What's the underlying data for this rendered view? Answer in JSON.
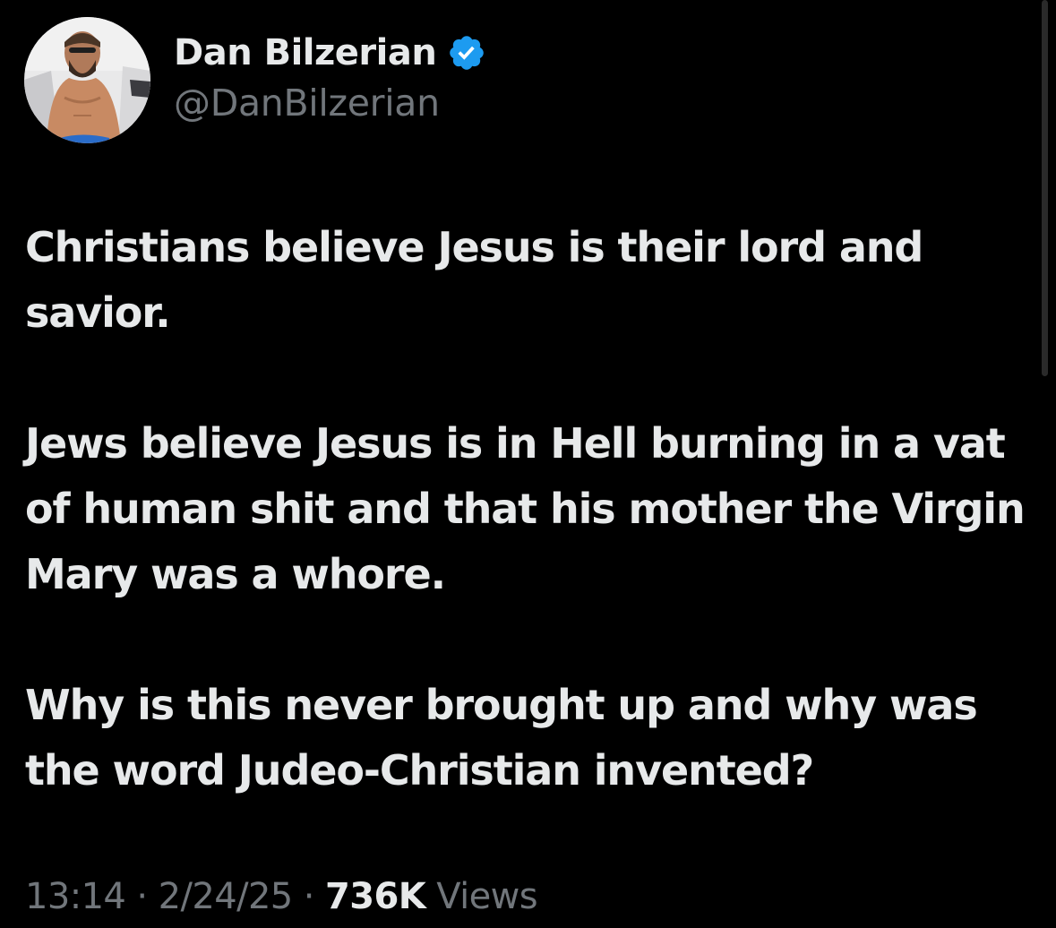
{
  "author": {
    "display_name": "Dan Bilzerian",
    "handle": "@DanBilzerian",
    "verified_icon": "verified-badge-icon",
    "verified_color": "#1d9bf0",
    "avatar": "profile-photo"
  },
  "tweet": {
    "paragraphs": [
      "Christians believe Jesus is their lord and savior.",
      "Jews believe Jesus is in Hell burning in a vat of human shit and that his mother the Virgin Mary was a whore.",
      "Why is this never brought up and why was the word Judeo-Christian invented?"
    ]
  },
  "meta": {
    "time": "13:14",
    "separator": "·",
    "date": "2/24/25",
    "views_count": "736K",
    "views_label": "Views"
  },
  "colors": {
    "background": "#000000",
    "primary_text": "#e7e9ea",
    "secondary_text": "#71767b"
  }
}
